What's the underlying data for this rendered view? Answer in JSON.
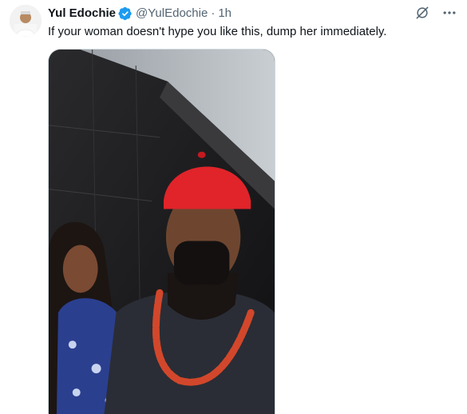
{
  "tweet": {
    "author_name": "Yul Edochie",
    "handle": "@YulEdochie",
    "separator": "·",
    "time": "1h",
    "text": "If your woman doesn't hype you like this, dump her immediately."
  },
  "icons": {
    "verified": "verified-badge-icon",
    "grok": "grok-icon",
    "more": "more-icon"
  },
  "colors": {
    "verified_blue": "#1d9bf0",
    "secondary_text": "#536471",
    "primary_text": "#0f1419"
  }
}
